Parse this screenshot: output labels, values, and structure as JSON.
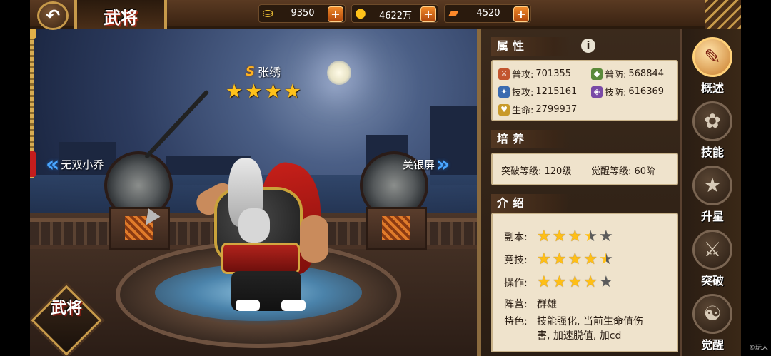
{
  "header": {
    "back_icon": "back-arrow-icon",
    "title": "武将",
    "currencies": [
      {
        "icon": "gold-ingot-icon",
        "value": "9350"
      },
      {
        "icon": "coin-icon",
        "value": "4622万"
      },
      {
        "icon": "scroll-token-icon",
        "value": "4520"
      }
    ],
    "plus_label": "+"
  },
  "hero": {
    "grade": "S",
    "name": "张绣",
    "stars": 4,
    "prev_hero": "无双小乔",
    "next_hero": "关银屏",
    "emblem": "武将"
  },
  "attributes": {
    "title": "属性",
    "info_label": "i",
    "stats": [
      {
        "label": "普攻:",
        "value": "701355",
        "icon": "normal-attack-icon",
        "color": "#c2552f"
      },
      {
        "label": "普防:",
        "value": "568844",
        "icon": "normal-defense-icon",
        "color": "#5a8a3a"
      },
      {
        "label": "技攻:",
        "value": "1215161",
        "icon": "skill-attack-icon",
        "color": "#3a6ab0"
      },
      {
        "label": "技防:",
        "value": "616369",
        "icon": "skill-defense-icon",
        "color": "#7a4aa6"
      },
      {
        "label": "生命:",
        "value": "2799937",
        "icon": "health-icon",
        "color": "#c99a2a"
      }
    ]
  },
  "training": {
    "title": "培养",
    "breakthrough": "突破等级: 120级",
    "awaken": "觉醒等级: 60阶"
  },
  "intro": {
    "title": "介绍",
    "ratings": [
      {
        "label": "副本:",
        "value": 3.5
      },
      {
        "label": "竞技:",
        "value": 4.5
      },
      {
        "label": "操作:",
        "value": 4
      }
    ],
    "faction_label": "阵营:",
    "faction": "群雄",
    "trait_label": "特色:",
    "trait_line1": "技能强化, 当前生命值伤",
    "trait_line2": "害, 加速脱值, 加cd"
  },
  "tabs": [
    {
      "label": "概述",
      "icon": "book-quill-icon",
      "active": true
    },
    {
      "label": "技能",
      "icon": "skill-book-icon",
      "active": false
    },
    {
      "label": "升星",
      "icon": "star-rise-icon",
      "active": false
    },
    {
      "label": "突破",
      "icon": "sword-break-icon",
      "active": false
    },
    {
      "label": "觉醒",
      "icon": "meditation-icon",
      "active": false
    }
  ],
  "watermark": "©玩人"
}
